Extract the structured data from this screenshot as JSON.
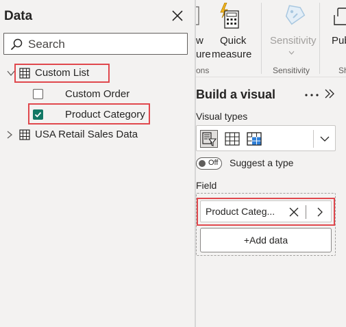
{
  "data_pane": {
    "title": "Data",
    "search": {
      "placeholder": "Search",
      "value": ""
    },
    "tables": [
      {
        "name": "Custom List",
        "expanded": true,
        "fields": [
          {
            "name": "Custom Order",
            "checked": false
          },
          {
            "name": "Product Category",
            "checked": true
          }
        ]
      },
      {
        "name": "USA Retail Sales Data",
        "expanded": false
      }
    ]
  },
  "ribbon": {
    "partial_button_line1": "w",
    "partial_button_line2": "ure",
    "partial_group_label": "ons",
    "quick_measure_line1": "Quick",
    "quick_measure_line2": "measure",
    "sensitivity_button": "Sensitivity",
    "sensitivity_group_label": "Sensitivity",
    "publish_partial": "Pub",
    "share_partial": "Sh"
  },
  "build_visual": {
    "title": "Build a visual",
    "visual_types_label": "Visual types",
    "toggle_text": "Off",
    "suggest_label": "Suggest a type",
    "field_label": "Field",
    "field_value": "Product Categ...",
    "add_data_label": "+Add data"
  },
  "colors": {
    "highlight": "#e0474c",
    "checkbox_checked": "#117865",
    "pane_bg": "#f3f2f1"
  },
  "icons": {
    "close": "close-icon",
    "search": "search-icon",
    "table": "table-icon",
    "more": "more-icon",
    "expand": "chevron-double-right-icon"
  }
}
